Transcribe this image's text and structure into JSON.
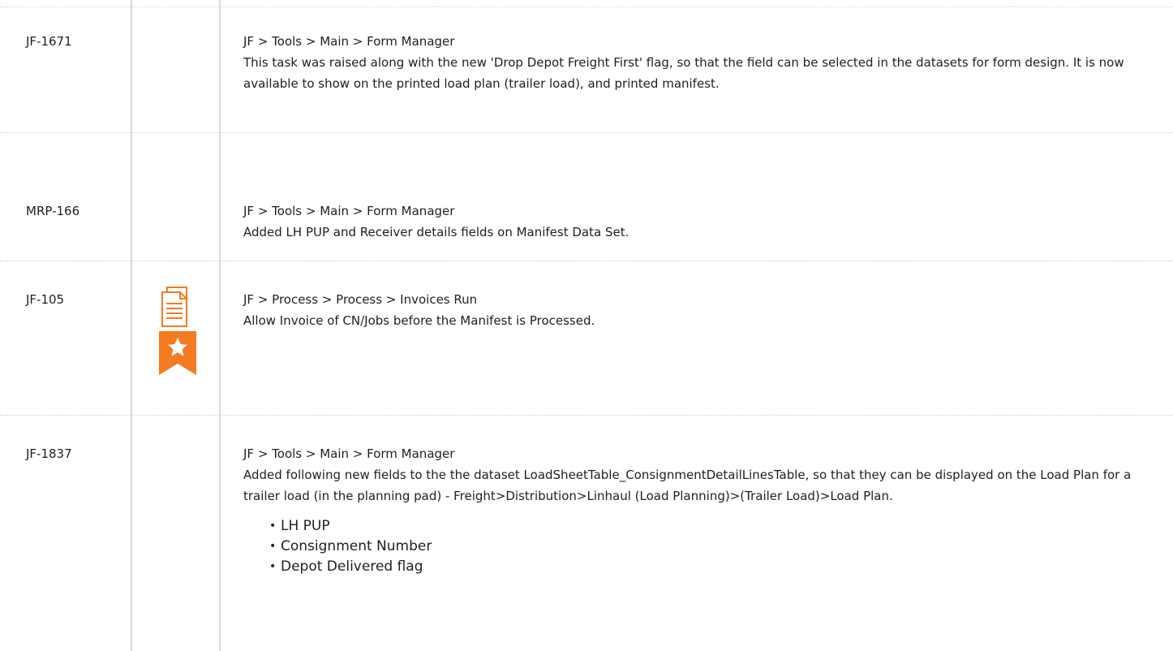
{
  "rows": [
    {
      "key": "JF-1671",
      "path": "JF > Tools > Main > Form Manager",
      "description": "This task was raised along with the new 'Drop Depot Freight First' flag, so that the field can be selected in the datasets for form design. It is now available to show on the printed load plan (trailer load), and printed manifest."
    },
    {
      "key": "MRP-166",
      "path": "JF > Tools > Main > Form Manager",
      "description": "Added LH PUP and Receiver details fields on Manifest Data Set."
    },
    {
      "key": "JF-105",
      "path": "JF > Process > Process > Invoices Run",
      "description": "Allow Invoice of CN/Jobs before the Manifest is Processed.",
      "icons": [
        "document-icon",
        "star-badge-icon"
      ]
    },
    {
      "key": "JF-1837",
      "path": "JF > Tools > Main > Form Manager",
      "description": "Added following new fields to the the dataset LoadSheetTable_ConsignmentDetailLinesTable, so that they can be displayed on the Load Plan for a trailer load (in the planning pad) - Freight>Distribution>Linhaul (Load Planning)>(Trailer Load)>Load Plan.",
      "bullets": [
        "LH PUP",
        "Consignment Number",
        "Depot Delivered flag"
      ]
    }
  ],
  "colors": {
    "icon_accent": "#f47b20",
    "border": "#d9d9d9"
  }
}
